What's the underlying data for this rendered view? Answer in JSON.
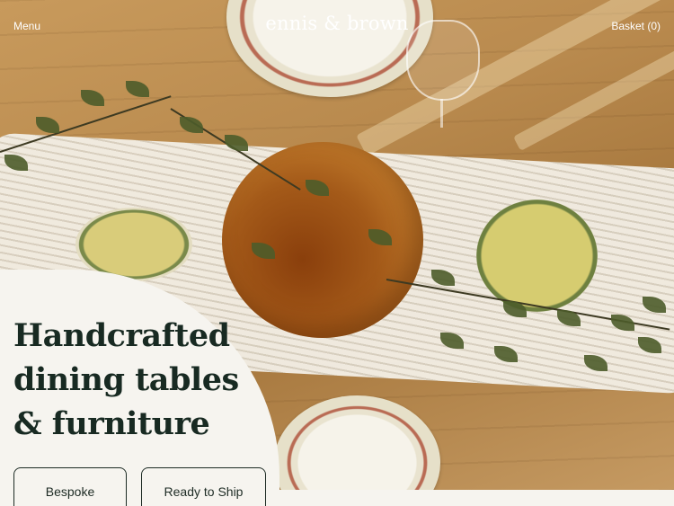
{
  "header": {
    "menu_label": "Menu",
    "logo_text": "ennis & brown",
    "basket_label": "Basket (0)"
  },
  "hero": {
    "title": "Handcrafted dining tables & furniture",
    "image_description_icon": "dining-table-photo",
    "buttons": {
      "bespoke": "Bespoke",
      "ready_to_ship": "Ready to Ship"
    }
  },
  "colors": {
    "text_dark": "#182a22",
    "card_bg": "#f6f4ef",
    "header_text": "#ffffff"
  }
}
